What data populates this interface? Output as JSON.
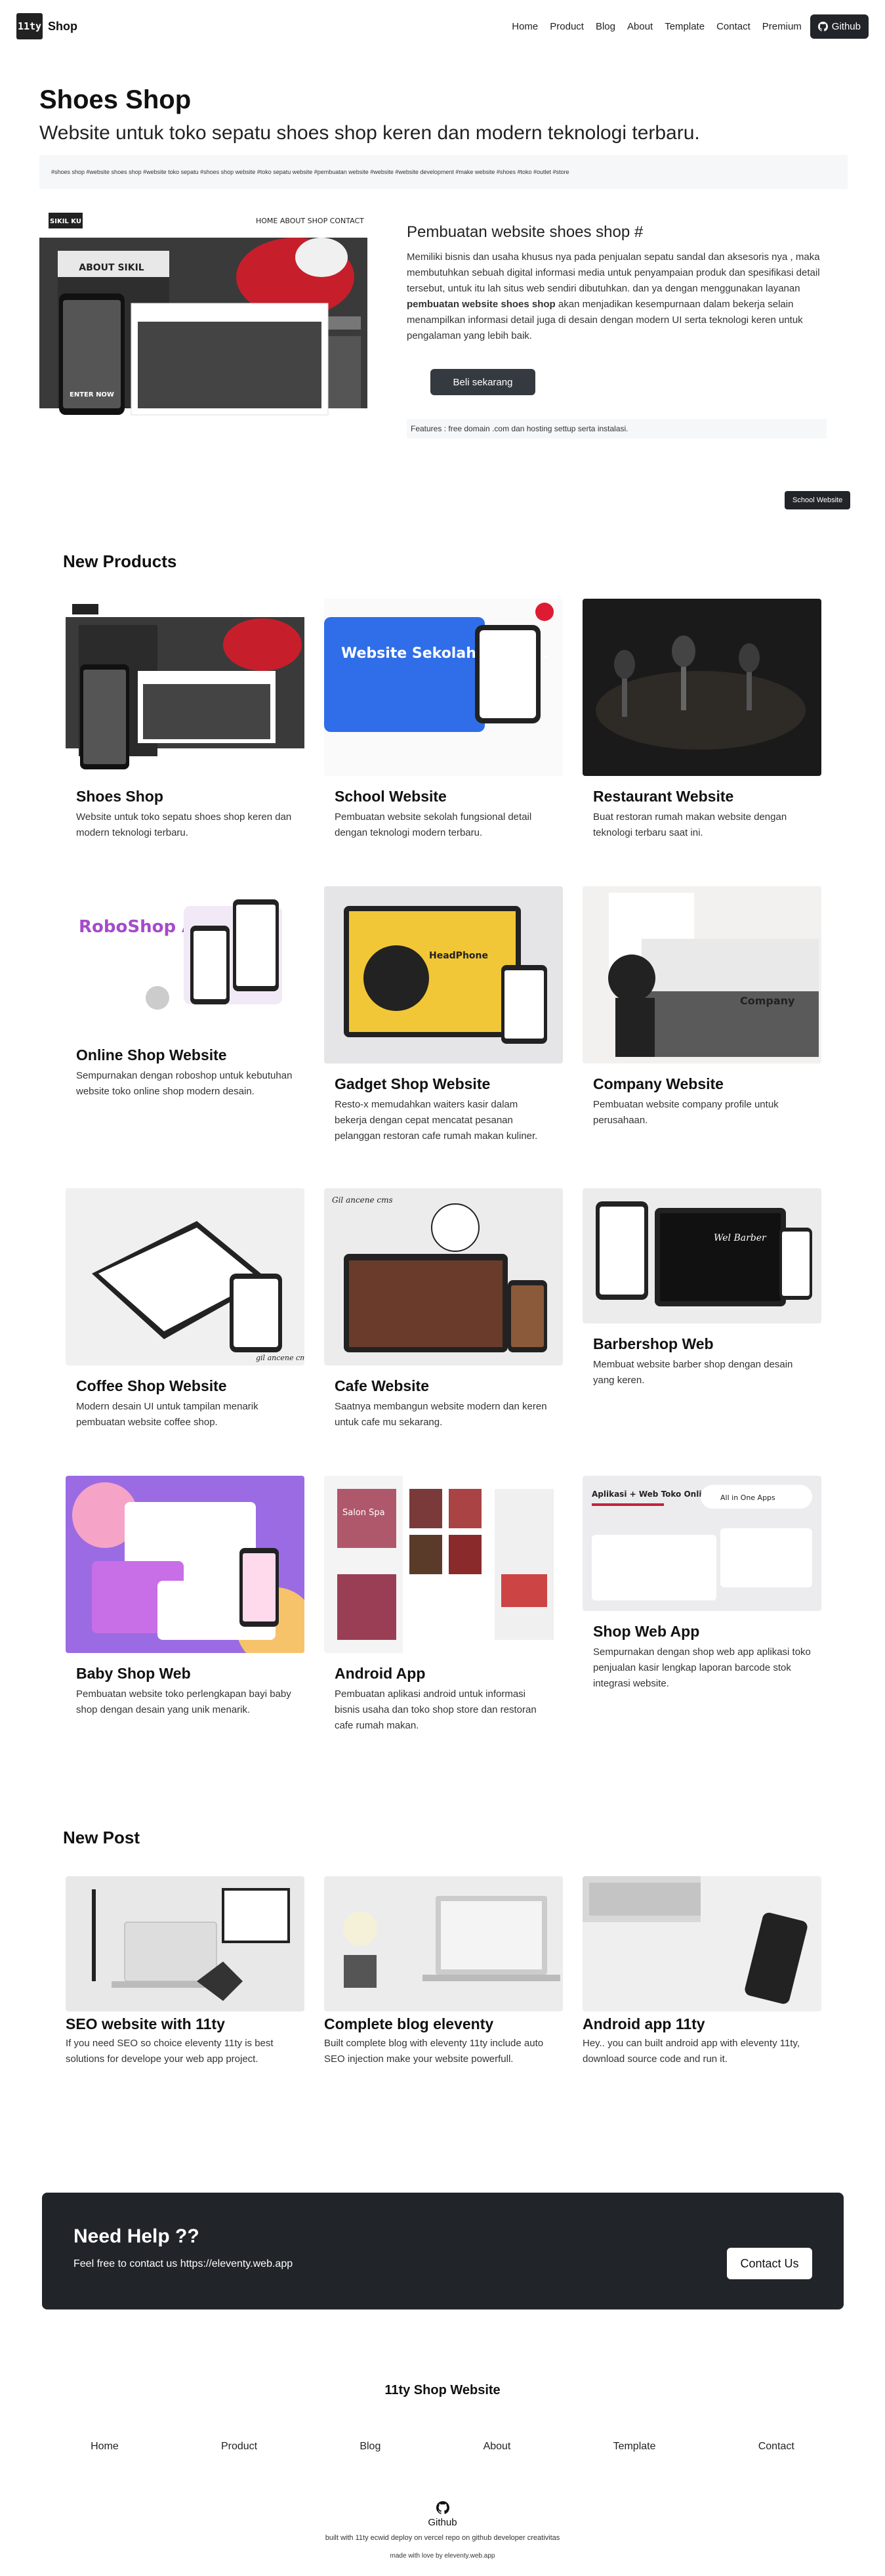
{
  "navbar": {
    "logo_text": "11ty",
    "brand": "Shop",
    "links": [
      "Home",
      "Product",
      "Blog",
      "About",
      "Template",
      "Contact",
      "Premium"
    ],
    "github_label": "Github"
  },
  "hero": {
    "title": "Shoes Shop",
    "subtitle": "Website untuk toko sepatu shoes shop keren dan modern teknologi terbaru.",
    "tags": "#shoes shop  #website shoes shop  #website toko sepatu  #shoes shop website  #toko sepatu website  #pembuatan website  #website  #website development  #make website  #shoes  #toko  #outlet  #store",
    "heading": "Pembuatan website shoes shop #",
    "desc_1": "Memiliki bisnis dan usaha khusus nya pada penjualan sepatu sandal dan aksesoris nya , maka membutuhkan sebuah digital informasi media untuk penyampaian produk dan spesifikasi detail tersebut, untuk itu lah situs web sendiri dibutuhkan. dan ya dengan menggunakan layanan ",
    "desc_bold": "pembuatan website shoes shop",
    "desc_2": " akan menjadikan kesempurnaan dalam bekerja selain menampilkan informasi detail juga di desain dengan modern UI serta teknologi keren untuk pengalaman yang lebih baik.",
    "buy_label": "Beli sekarang",
    "features": "Features : free domain .com dan hosting settup serta instalasi.",
    "school_button": "School Website",
    "mockup_brand": "SIKIL KU",
    "mockup_nav": "HOME   ABOUT   SHOP   CONTACT",
    "mockup_about": "ABOUT SIKIL",
    "mockup_cta": "ENTER NOW"
  },
  "products": {
    "title": "New Products",
    "items": [
      {
        "name": "Shoes Shop",
        "desc": "Website untuk toko sepatu shoes shop keren dan modern teknologi terbaru."
      },
      {
        "name": "School Website",
        "desc": "Pembuatan website sekolah fungsional detail dengan teknologi modern terbaru.",
        "thumb_text": "Website Sekolah Modern."
      },
      {
        "name": "Restaurant Website",
        "desc": "Buat restoran rumah makan website dengan teknologi terbaru saat ini."
      },
      {
        "name": "Online Shop Website",
        "desc": "Sempurnakan dengan roboshop untuk kebutuhan website toko online shop modern desain.",
        "thumb_text": "RoboShop Apps"
      },
      {
        "name": "Gadget Shop Website",
        "desc": "Resto-x memudahkan waiters kasir dalam bekerja dengan cepat mencatat pesanan pelanggan restoran cafe rumah makan kuliner.",
        "thumb_text": "HeadPhone"
      },
      {
        "name": "Company Website",
        "desc": "Pembuatan website company profile untuk perusahaan.",
        "thumb_text": "Company"
      },
      {
        "name": "Coffee Shop Website",
        "desc": "Modern desain UI untuk tampilan menarik pembuatan website coffee shop.",
        "thumb_text": "gil ancene cms"
      },
      {
        "name": "Cafe Website",
        "desc": "Saatnya membangun website modern dan keren untuk cafe mu sekarang.",
        "thumb_text": "Gil ancene cms"
      },
      {
        "name": "Barbershop Web",
        "desc": "Membuat website barber shop dengan desain yang keren.",
        "thumb_text": "Wel Barber"
      },
      {
        "name": "Baby Shop Web",
        "desc": "Pembuatan website toko perlengkapan bayi baby shop dengan desain yang unik menarik."
      },
      {
        "name": "Android App",
        "desc": "Pembuatan aplikasi android untuk informasi bisnis usaha dan toko shop store dan restoran cafe rumah makan.",
        "thumb_text": "Salon Spa"
      },
      {
        "name": "Shop Web App",
        "desc": "Sempurnakan dengan shop web app aplikasi toko penjualan kasir lengkap laporan barcode stok integrasi website.",
        "thumb_text": "Aplikasi + Web Toko Online Shop",
        "thumb_badge": "All in One Apps"
      }
    ]
  },
  "posts": {
    "title": "New Post",
    "items": [
      {
        "name": "SEO website with 11ty",
        "desc": "If you need SEO so choice eleventy 11ty is best solutions for develope your web app project."
      },
      {
        "name": "Complete blog eleventy",
        "desc": "Built complete blog with eleventy 11ty include auto SEO injection make your website powerfull."
      },
      {
        "name": "Android app 11ty",
        "desc": "Hey.. you can built android app with eleventy 11ty, download source code and run it."
      }
    ]
  },
  "help": {
    "title": "Need Help ??",
    "text": "Feel free to contact us https://eleventy.web.app",
    "button": "Contact Us"
  },
  "footer": {
    "title": "11ty Shop Website",
    "links": [
      "Home",
      "Product",
      "Blog",
      "About",
      "Template",
      "Contact"
    ],
    "github": "Github",
    "built": "built with 11ty ecwid deploy on vercel repo on github developer creativitas",
    "love": "made with love by eleventy.web.app"
  },
  "colors": {
    "dark": "#212529",
    "light_bg": "#f6f7f9",
    "accent_blue": "#2f6ee8",
    "accent_purple": "#a64ac9"
  }
}
